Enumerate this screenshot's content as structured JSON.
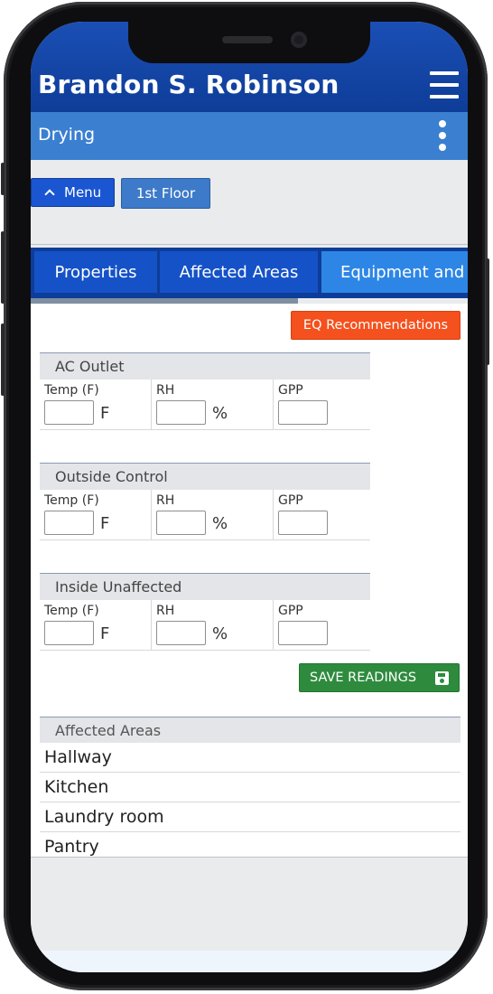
{
  "header": {
    "user_name": "Brandon S. Robinson"
  },
  "subheader": {
    "title": "Drying"
  },
  "nav_buttons": {
    "menu_label": "Menu",
    "floor_label": "1st Floor"
  },
  "tabs": [
    {
      "label": "Properties"
    },
    {
      "label": "Affected Areas"
    },
    {
      "label": "Equipment and"
    }
  ],
  "actions": {
    "eq_recommendations": "EQ Recommendations",
    "save_readings": "SAVE READINGS"
  },
  "readings": [
    {
      "title": "AC Outlet",
      "temp_label": "Temp (F)",
      "temp_unit": "F",
      "rh_label": "RH",
      "rh_unit": "%",
      "gpp_label": "GPP",
      "temp_value": "",
      "rh_value": "",
      "gpp_value": ""
    },
    {
      "title": "Outside Control",
      "temp_label": "Temp (F)",
      "temp_unit": "F",
      "rh_label": "RH",
      "rh_unit": "%",
      "gpp_label": "GPP",
      "temp_value": "",
      "rh_value": "",
      "gpp_value": ""
    },
    {
      "title": "Inside Unaffected",
      "temp_label": "Temp (F)",
      "temp_unit": "F",
      "rh_label": "RH",
      "rh_unit": "%",
      "gpp_label": "GPP",
      "temp_value": "",
      "rh_value": "",
      "gpp_value": ""
    }
  ],
  "affected_areas": {
    "title": "Affected Areas",
    "items": [
      "Hallway",
      "Kitchen",
      "Laundry room",
      "Pantry"
    ]
  },
  "colors": {
    "header_blue": "#0e3d98",
    "subheader_blue": "#3b7fd0",
    "eq_orange": "#f4511e",
    "save_green": "#2e8b3e"
  }
}
